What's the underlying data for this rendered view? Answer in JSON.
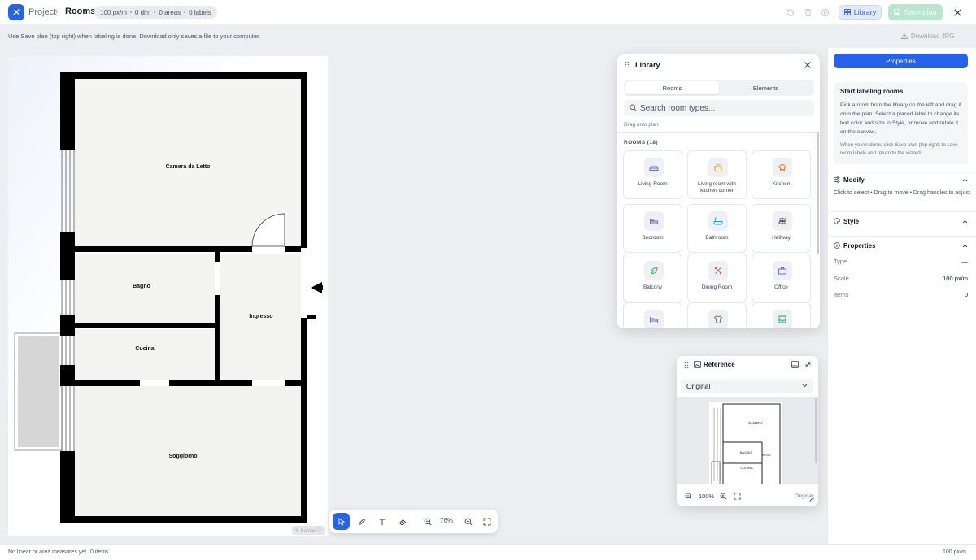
{
  "header": {
    "crumb_project": "Project",
    "crumb_sep": "›",
    "crumb_page": "Rooms",
    "stats": [
      "100 px/m",
      "0 dim",
      "0 areas",
      "0 labels"
    ],
    "library_label": "Library",
    "save_label": "Save plan"
  },
  "hint": "Use Save plan (top right) when labeling is done. Download only saves a file to your computer.",
  "download_label": "Download JPG",
  "plan": {
    "rooms": [
      {
        "label": "Camera da Letto"
      },
      {
        "label": "Bagno"
      },
      {
        "label": "Ingresso"
      },
      {
        "label": "Cucina"
      },
      {
        "label": "Soggiorno"
      }
    ],
    "watermark": "✎ Banlan ⓘ"
  },
  "toolbar": {
    "zoom": "76%"
  },
  "library": {
    "title": "Library",
    "tabs": [
      "Rooms",
      "Elements"
    ],
    "search_placeholder": "Search room types...",
    "drag_hint": "Drag onto plan",
    "rooms_header": "ROOMS (18)",
    "items": [
      {
        "label": "Living Room",
        "icon": "sofa-icon",
        "color": "#4f6bd8"
      },
      {
        "label": "Living room with kitchen corner",
        "icon": "pot-icon",
        "color": "#d9901a"
      },
      {
        "label": "Kitchen",
        "icon": "chef-hat-icon",
        "color": "#e07a2e"
      },
      {
        "label": "Bedroom",
        "icon": "bed-icon",
        "color": "#7c5cd6"
      },
      {
        "label": "Bathroom",
        "icon": "bathtub-icon",
        "color": "#1aa6c7"
      },
      {
        "label": "Hallway",
        "icon": "signpost-icon",
        "color": "#4b5563"
      },
      {
        "label": "Balcony",
        "icon": "leaf-icon",
        "color": "#2fa84f"
      },
      {
        "label": "Dining Room",
        "icon": "utensils-icon",
        "color": "#d6336c"
      },
      {
        "label": "Office",
        "icon": "briefcase-icon",
        "color": "#4f6bd8"
      },
      {
        "label": "",
        "icon": "bed-icon",
        "color": "#7c5cd6"
      },
      {
        "label": "",
        "icon": "shirt-icon",
        "color": "#6b7280"
      },
      {
        "label": "",
        "icon": "box-icon",
        "color": "#14a37a"
      }
    ]
  },
  "reference": {
    "title": "Reference",
    "select_value": "Original",
    "zoom": "100%",
    "mode": "Original",
    "labels": [
      "CAMERA",
      "BAGNO",
      "INGR.",
      "CUCINA"
    ]
  },
  "properties": {
    "tab_label": "Properties",
    "start_title": "Start labeling rooms",
    "start_body": "Pick a room from the library on the left and drag it onto the plan. Select a placed label to change its text color and size in Style, or move and rotate it on the canvas.",
    "start_body2": "When you're done, click Save plan (top right) to save room labels and return to the wizard.",
    "modify_title": "Modify",
    "modify_hint": "Click to select • Drag to move • Drag handles to adjust",
    "style_title": "Style",
    "props_title": "Properties",
    "rows": [
      {
        "key": "Type",
        "value": "—"
      },
      {
        "key": "Scale",
        "value": "100 px/m"
      },
      {
        "key": "Items",
        "value": "0"
      }
    ]
  },
  "footer": {
    "measures": "No linear or area measures yet",
    "items": "0 items",
    "scale": "100 px/m"
  }
}
